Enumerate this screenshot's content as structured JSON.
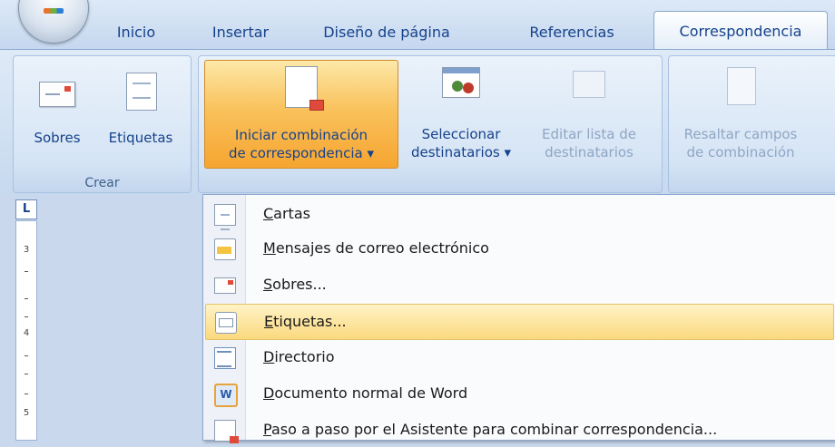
{
  "tabs": [
    "Inicio",
    "Insertar",
    "Diseño de página",
    "Referencias",
    "Correspondencia"
  ],
  "ribbon": {
    "group_crear": {
      "label": "Crear",
      "buttons": [
        "Sobres",
        "Etiquetas"
      ]
    },
    "start_merge": {
      "line1": "Iniciar combinación",
      "line2": "de correspondencia"
    },
    "select_recipients": {
      "line1": "Seleccionar",
      "line2": "destinatarios"
    },
    "edit_list": {
      "line1": "Editar lista de",
      "line2": "destinatarios"
    },
    "highlight_fields": {
      "line1": "Resaltar campos",
      "line2": "de combinación"
    }
  },
  "ruler": {
    "corner": "L",
    "numbers": [
      "3",
      "4",
      "5"
    ]
  },
  "menu": {
    "items": [
      {
        "label": "Cartas",
        "icon": "document-icon"
      },
      {
        "label": "Mensajes de correo electrónico",
        "icon": "email-message-icon"
      },
      {
        "label": "Sobres...",
        "icon": "envelope-icon"
      },
      {
        "label": "Etiquetas...",
        "icon": "labels-icon",
        "highlighted": true
      },
      {
        "label": "Directorio",
        "icon": "directory-icon"
      },
      {
        "label": "Documento normal de Word",
        "icon": "word-document-icon"
      },
      {
        "label": "Paso a paso por el Asistente para combinar correspondencia...",
        "icon": "wizard-icon"
      }
    ]
  },
  "colors": {
    "accent": "#15428b",
    "highlight": "#f9c25c"
  }
}
